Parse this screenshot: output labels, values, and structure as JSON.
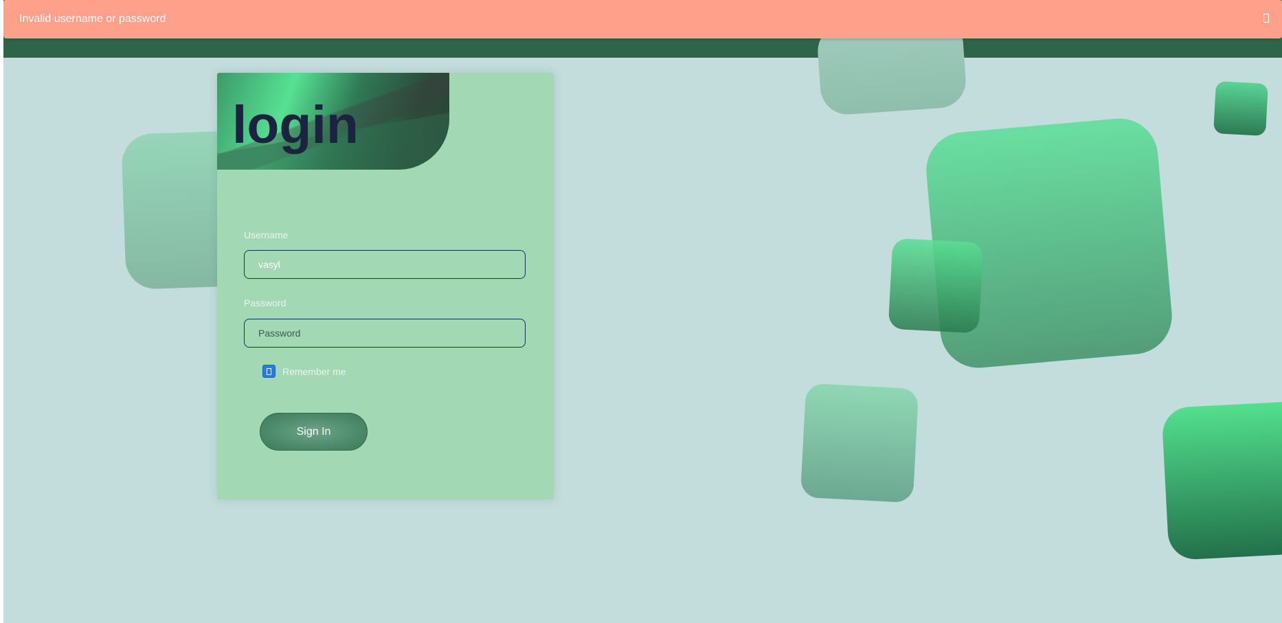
{
  "alert": {
    "message": "Invalid username or password",
    "close_icon": "close-icon",
    "color": "#ffa08a"
  },
  "login": {
    "title": "login",
    "username": {
      "label": "Username",
      "value": "vasyl"
    },
    "password": {
      "label": "Password",
      "placeholder": "Password",
      "value": ""
    },
    "remember_me": {
      "label": "Remember me",
      "checked": true
    },
    "sign_in_label": "Sign In"
  },
  "colors": {
    "page_background": "#c3dcdc",
    "topbar": "#2e6548",
    "card": "#a2d8b4",
    "title": "#1b2340",
    "accent_checkbox": "#1f7fe6"
  }
}
